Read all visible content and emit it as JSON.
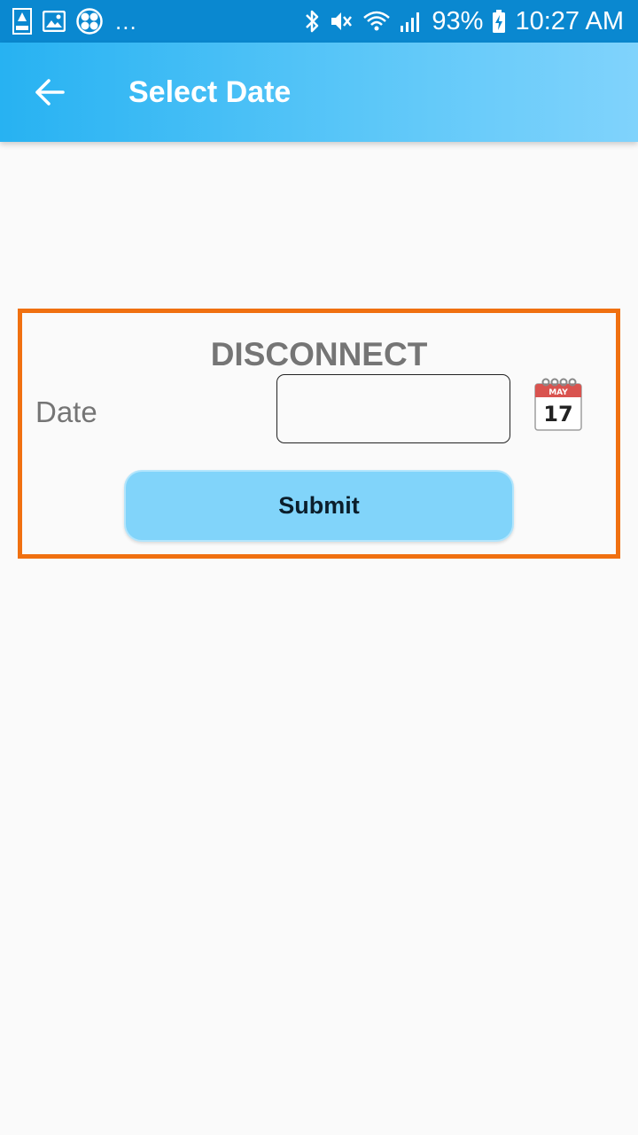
{
  "status_bar": {
    "battery": "93%",
    "time": "10:27 AM",
    "more": "...",
    "icons": [
      "app-live-icon",
      "image-icon",
      "fan-icon",
      "bluetooth-icon",
      "mute-icon",
      "wifi-icon",
      "signal-icon",
      "battery-charging-icon"
    ]
  },
  "app_bar": {
    "title": "Select Date",
    "back_icon": "arrow-left-icon"
  },
  "card": {
    "heading": "DISCONNECT",
    "date_label": "Date",
    "date_value": "",
    "calendar_icon": {
      "name": "calendar-icon",
      "month": "MAY",
      "day": "17"
    },
    "submit_label": "Submit"
  },
  "colors": {
    "status_bar": "#0a88d0",
    "app_bar_start": "#27b2f2",
    "app_bar_end": "#80d3fc",
    "card_border": "#f07010",
    "submit_bg": "#81d4fa",
    "text_grey": "#757575"
  }
}
